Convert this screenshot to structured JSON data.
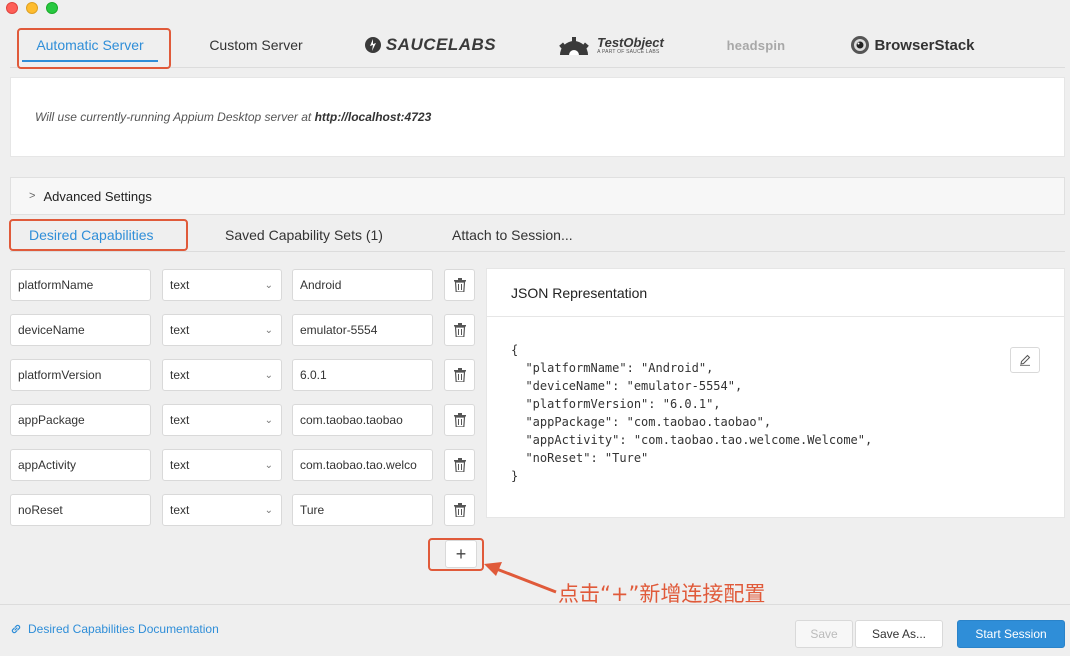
{
  "server_tabs": [
    {
      "label": "Automatic Server",
      "active": true
    },
    {
      "label": "Custom Server",
      "active": false
    },
    {
      "label": "SAUCELABS",
      "logo": "saucelabs-logo"
    },
    {
      "label": "TestObject",
      "sub": "A PART OF SAUCE LABS",
      "logo": "testobject-logo"
    },
    {
      "label": "headspin",
      "logo": "headspin-logo"
    },
    {
      "label": "BrowserStack",
      "logo": "browserstack-logo"
    }
  ],
  "info": {
    "prefix": "Will use currently-running Appium Desktop server at ",
    "url": "http://localhost:4723"
  },
  "advanced_settings": {
    "label": "Advanced Settings"
  },
  "capability_tabs": [
    {
      "label": "Desired Capabilities",
      "active": true
    },
    {
      "label": "Saved Capability Sets (1)",
      "active": false
    },
    {
      "label": "Attach to Session...",
      "active": false
    }
  ],
  "capabilities": [
    {
      "name": "platformName",
      "type": "text",
      "value": "Android"
    },
    {
      "name": "deviceName",
      "type": "text",
      "value": "emulator-5554"
    },
    {
      "name": "platformVersion",
      "type": "text",
      "value": "6.0.1"
    },
    {
      "name": "appPackage",
      "type": "text",
      "value": "com.taobao.taobao"
    },
    {
      "name": "appActivity",
      "type": "text",
      "value": "com.taobao.tao.welco"
    },
    {
      "name": "noReset",
      "type": "text",
      "value": "Ture"
    }
  ],
  "json_panel": {
    "title": "JSON Representation",
    "content": "{\n  \"platformName\": \"Android\",\n  \"deviceName\": \"emulator-5554\",\n  \"platformVersion\": \"6.0.1\",\n  \"appPackage\": \"com.taobao.taobao\",\n  \"appActivity\": \"com.taobao.tao.welcome.Welcome\",\n  \"noReset\": \"Ture\"\n}"
  },
  "add_button": {
    "label": "+"
  },
  "annotation": {
    "text": "点击“+”新增连接配置",
    "color": "#e05a3a"
  },
  "footer": {
    "doc_link": "Desired Capabilities Documentation",
    "save": "Save",
    "save_as": "Save As...",
    "start": "Start Session"
  },
  "colors": {
    "accent": "#2f8ed8",
    "annotation": "#e05a3a"
  }
}
